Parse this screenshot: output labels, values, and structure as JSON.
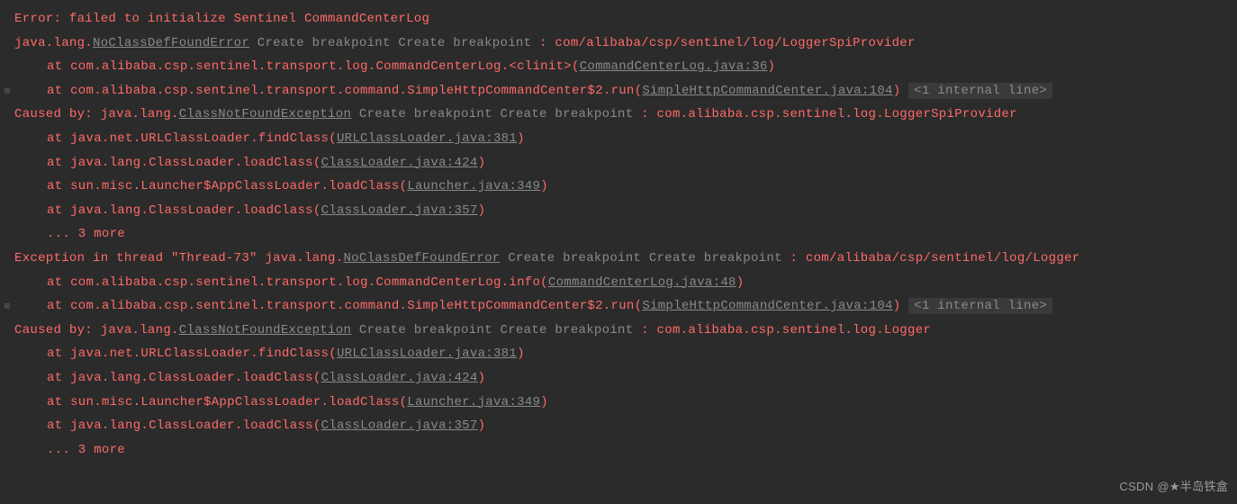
{
  "lines": [
    {
      "gutter": "",
      "parts": [
        {
          "type": "text",
          "cls": "error",
          "text": "Error: failed to initialize Sentinel CommandCenterLog"
        }
      ],
      "pad": 16
    },
    {
      "gutter": "",
      "parts": [
        {
          "type": "text",
          "cls": "error",
          "text": "java.lang."
        },
        {
          "type": "link",
          "cls": "underline-link",
          "text": "NoClassDefFoundError"
        },
        {
          "type": "text",
          "cls": "",
          "text": " "
        },
        {
          "type": "link",
          "cls": "breakpoint",
          "text": "Create breakpoint"
        },
        {
          "type": "text",
          "cls": "",
          "text": "  "
        },
        {
          "type": "link",
          "cls": "breakpoint",
          "text": "Create breakpoint"
        },
        {
          "type": "text",
          "cls": "error",
          "text": " : com/alibaba/csp/sentinel/log/LoggerSpiProvider"
        }
      ],
      "pad": 16
    },
    {
      "gutter": "",
      "parts": [
        {
          "type": "text",
          "cls": "error",
          "text": "at com.alibaba.csp.sentinel.transport.log.CommandCenterLog.<clinit>("
        },
        {
          "type": "link",
          "cls": "file-link",
          "text": "CommandCenterLog.java:36"
        },
        {
          "type": "text",
          "cls": "error",
          "text": ")"
        }
      ],
      "pad": 52
    },
    {
      "gutter": "+",
      "parts": [
        {
          "type": "text",
          "cls": "error",
          "text": "at com.alibaba.csp.sentinel.transport.command.SimpleHttpCommandCenter$2.run("
        },
        {
          "type": "link",
          "cls": "file-link",
          "text": "SimpleHttpCommandCenter.java:104"
        },
        {
          "type": "text",
          "cls": "error",
          "text": ") "
        },
        {
          "type": "link",
          "cls": "internal-line",
          "text": "<1 internal line>"
        }
      ],
      "pad": 52
    },
    {
      "gutter": "",
      "parts": [
        {
          "type": "text",
          "cls": "error",
          "text": "Caused by: java.lang."
        },
        {
          "type": "link",
          "cls": "underline-link",
          "text": "ClassNotFoundException"
        },
        {
          "type": "text",
          "cls": "",
          "text": " "
        },
        {
          "type": "link",
          "cls": "breakpoint",
          "text": "Create breakpoint"
        },
        {
          "type": "text",
          "cls": "",
          "text": "  "
        },
        {
          "type": "link",
          "cls": "breakpoint",
          "text": "Create breakpoint"
        },
        {
          "type": "text",
          "cls": "error",
          "text": " : com.alibaba.csp.sentinel.log.LoggerSpiProvider"
        }
      ],
      "pad": 16
    },
    {
      "gutter": "",
      "parts": [
        {
          "type": "text",
          "cls": "error",
          "text": "at java.net.URLClassLoader.findClass("
        },
        {
          "type": "link",
          "cls": "file-link",
          "text": "URLClassLoader.java:381"
        },
        {
          "type": "text",
          "cls": "error",
          "text": ")"
        }
      ],
      "pad": 52
    },
    {
      "gutter": "",
      "parts": [
        {
          "type": "text",
          "cls": "error",
          "text": "at java.lang.ClassLoader.loadClass("
        },
        {
          "type": "link",
          "cls": "file-link",
          "text": "ClassLoader.java:424"
        },
        {
          "type": "text",
          "cls": "error",
          "text": ")"
        }
      ],
      "pad": 52
    },
    {
      "gutter": "",
      "parts": [
        {
          "type": "text",
          "cls": "error",
          "text": "at sun.misc.Launcher$AppClassLoader.loadClass("
        },
        {
          "type": "link",
          "cls": "file-link",
          "text": "Launcher.java:349"
        },
        {
          "type": "text",
          "cls": "error",
          "text": ")"
        }
      ],
      "pad": 52
    },
    {
      "gutter": "",
      "parts": [
        {
          "type": "text",
          "cls": "error",
          "text": "at java.lang.ClassLoader.loadClass("
        },
        {
          "type": "link",
          "cls": "file-link",
          "text": "ClassLoader.java:357"
        },
        {
          "type": "text",
          "cls": "error",
          "text": ")"
        }
      ],
      "pad": 52
    },
    {
      "gutter": "",
      "parts": [
        {
          "type": "text",
          "cls": "error",
          "text": "... 3 more"
        }
      ],
      "pad": 52
    },
    {
      "gutter": "",
      "parts": [
        {
          "type": "text",
          "cls": "error",
          "text": "Exception in thread \"Thread-73\" java.lang."
        },
        {
          "type": "link",
          "cls": "underline-link",
          "text": "NoClassDefFoundError"
        },
        {
          "type": "text",
          "cls": "",
          "text": " "
        },
        {
          "type": "link",
          "cls": "breakpoint",
          "text": "Create breakpoint"
        },
        {
          "type": "text",
          "cls": "",
          "text": "  "
        },
        {
          "type": "link",
          "cls": "breakpoint",
          "text": "Create breakpoint"
        },
        {
          "type": "text",
          "cls": "error",
          "text": " : com/alibaba/csp/sentinel/log/Logger"
        }
      ],
      "pad": 16
    },
    {
      "gutter": "",
      "parts": [
        {
          "type": "text",
          "cls": "error",
          "text": "at com.alibaba.csp.sentinel.transport.log.CommandCenterLog.info("
        },
        {
          "type": "link",
          "cls": "file-link",
          "text": "CommandCenterLog.java:48"
        },
        {
          "type": "text",
          "cls": "error",
          "text": ")"
        }
      ],
      "pad": 52
    },
    {
      "gutter": "+",
      "parts": [
        {
          "type": "text",
          "cls": "error",
          "text": "at com.alibaba.csp.sentinel.transport.command.SimpleHttpCommandCenter$2.run("
        },
        {
          "type": "link",
          "cls": "file-link",
          "text": "SimpleHttpCommandCenter.java:104"
        },
        {
          "type": "text",
          "cls": "error",
          "text": ") "
        },
        {
          "type": "link",
          "cls": "internal-line",
          "text": "<1 internal line>"
        }
      ],
      "pad": 52
    },
    {
      "gutter": "",
      "parts": [
        {
          "type": "text",
          "cls": "error",
          "text": "Caused by: java.lang."
        },
        {
          "type": "link",
          "cls": "underline-link",
          "text": "ClassNotFoundException"
        },
        {
          "type": "text",
          "cls": "",
          "text": " "
        },
        {
          "type": "link",
          "cls": "breakpoint",
          "text": "Create breakpoint"
        },
        {
          "type": "text",
          "cls": "",
          "text": "  "
        },
        {
          "type": "link",
          "cls": "breakpoint",
          "text": "Create breakpoint"
        },
        {
          "type": "text",
          "cls": "error",
          "text": " : com.alibaba.csp.sentinel.log.Logger"
        }
      ],
      "pad": 16
    },
    {
      "gutter": "",
      "parts": [
        {
          "type": "text",
          "cls": "error",
          "text": "at java.net.URLClassLoader.findClass("
        },
        {
          "type": "link",
          "cls": "file-link",
          "text": "URLClassLoader.java:381"
        },
        {
          "type": "text",
          "cls": "error",
          "text": ")"
        }
      ],
      "pad": 52
    },
    {
      "gutter": "",
      "parts": [
        {
          "type": "text",
          "cls": "error",
          "text": "at java.lang.ClassLoader.loadClass("
        },
        {
          "type": "link",
          "cls": "file-link",
          "text": "ClassLoader.java:424"
        },
        {
          "type": "text",
          "cls": "error",
          "text": ")"
        }
      ],
      "pad": 52
    },
    {
      "gutter": "",
      "parts": [
        {
          "type": "text",
          "cls": "error",
          "text": "at sun.misc.Launcher$AppClassLoader.loadClass("
        },
        {
          "type": "link",
          "cls": "file-link",
          "text": "Launcher.java:349"
        },
        {
          "type": "text",
          "cls": "error",
          "text": ")"
        }
      ],
      "pad": 52
    },
    {
      "gutter": "",
      "parts": [
        {
          "type": "text",
          "cls": "error",
          "text": "at java.lang.ClassLoader.loadClass("
        },
        {
          "type": "link",
          "cls": "file-link",
          "text": "ClassLoader.java:357"
        },
        {
          "type": "text",
          "cls": "error",
          "text": ")"
        }
      ],
      "pad": 52
    },
    {
      "gutter": "",
      "parts": [
        {
          "type": "text",
          "cls": "error",
          "text": "... 3 more"
        }
      ],
      "pad": 52
    }
  ],
  "watermark": "CSDN @★半岛铁盒"
}
